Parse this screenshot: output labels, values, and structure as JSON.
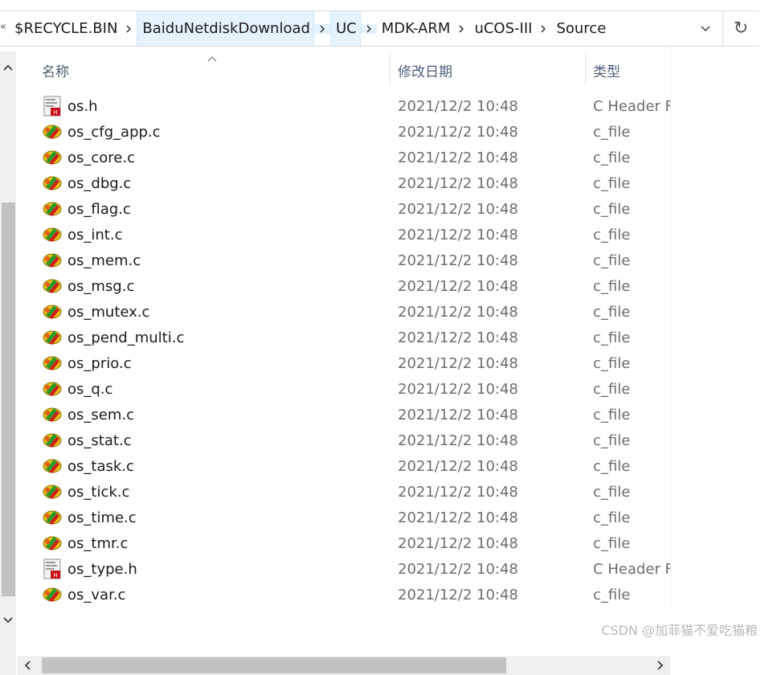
{
  "address_bar": {
    "overflow_glyph": "«",
    "crumbs": [
      "$RECYCLE.BIN",
      "BaiduNetdiskDownload",
      "UC",
      "MDK-ARM",
      "uCOS-III",
      "Source"
    ],
    "refresh_glyph": "↻"
  },
  "columns": {
    "name": "名称",
    "date": "修改日期",
    "type": "类型"
  },
  "files": [
    {
      "name": "os.h",
      "date": "2021/12/2 10:48",
      "type": "C Header F",
      "icon": "c-header-file-icon"
    },
    {
      "name": "os_cfg_app.c",
      "date": "2021/12/2 10:48",
      "type": "c_file",
      "icon": "c-source-file-icon"
    },
    {
      "name": "os_core.c",
      "date": "2021/12/2 10:48",
      "type": "c_file",
      "icon": "c-source-file-icon"
    },
    {
      "name": "os_dbg.c",
      "date": "2021/12/2 10:48",
      "type": "c_file",
      "icon": "c-source-file-icon"
    },
    {
      "name": "os_flag.c",
      "date": "2021/12/2 10:48",
      "type": "c_file",
      "icon": "c-source-file-icon"
    },
    {
      "name": "os_int.c",
      "date": "2021/12/2 10:48",
      "type": "c_file",
      "icon": "c-source-file-icon"
    },
    {
      "name": "os_mem.c",
      "date": "2021/12/2 10:48",
      "type": "c_file",
      "icon": "c-source-file-icon"
    },
    {
      "name": "os_msg.c",
      "date": "2021/12/2 10:48",
      "type": "c_file",
      "icon": "c-source-file-icon"
    },
    {
      "name": "os_mutex.c",
      "date": "2021/12/2 10:48",
      "type": "c_file",
      "icon": "c-source-file-icon"
    },
    {
      "name": "os_pend_multi.c",
      "date": "2021/12/2 10:48",
      "type": "c_file",
      "icon": "c-source-file-icon"
    },
    {
      "name": "os_prio.c",
      "date": "2021/12/2 10:48",
      "type": "c_file",
      "icon": "c-source-file-icon"
    },
    {
      "name": "os_q.c",
      "date": "2021/12/2 10:48",
      "type": "c_file",
      "icon": "c-source-file-icon"
    },
    {
      "name": "os_sem.c",
      "date": "2021/12/2 10:48",
      "type": "c_file",
      "icon": "c-source-file-icon"
    },
    {
      "name": "os_stat.c",
      "date": "2021/12/2 10:48",
      "type": "c_file",
      "icon": "c-source-file-icon"
    },
    {
      "name": "os_task.c",
      "date": "2021/12/2 10:48",
      "type": "c_file",
      "icon": "c-source-file-icon"
    },
    {
      "name": "os_tick.c",
      "date": "2021/12/2 10:48",
      "type": "c_file",
      "icon": "c-source-file-icon"
    },
    {
      "name": "os_time.c",
      "date": "2021/12/2 10:48",
      "type": "c_file",
      "icon": "c-source-file-icon"
    },
    {
      "name": "os_tmr.c",
      "date": "2021/12/2 10:48",
      "type": "c_file",
      "icon": "c-source-file-icon"
    },
    {
      "name": "os_type.h",
      "date": "2021/12/2 10:48",
      "type": "C Header F",
      "icon": "c-header-file-icon"
    },
    {
      "name": "os_var.c",
      "date": "2021/12/2 10:48",
      "type": "c_file",
      "icon": "c-source-file-icon"
    }
  ],
  "watermark": "CSDN @加菲猫不爱吃猫粮",
  "colors": {
    "crumb_highlight": "#e5f3ff",
    "header_text": "#4c607a",
    "secondary_text": "#6d6d6d",
    "scrollbar_track": "#f0f0f0",
    "scrollbar_thumb": "#c2c2c2"
  }
}
